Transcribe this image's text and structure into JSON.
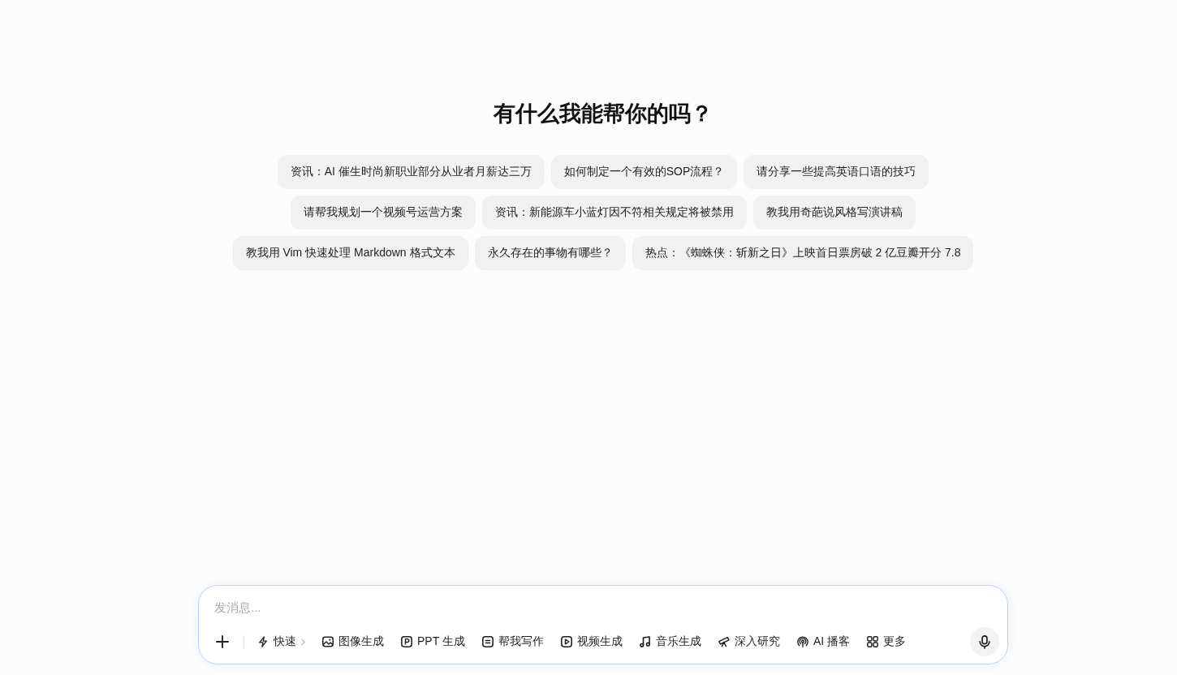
{
  "heading": "有什么我能帮你的吗？",
  "suggestion_rows": [
    [
      "资讯：AI 催生时尚新职业部分从业者月薪达三万",
      "如何制定一个有效的SOP流程？",
      "请分享一些提高英语口语的技巧"
    ],
    [
      "请帮我规划一个视频号运营方案",
      "资讯：新能源车小蓝灯因不符相关规定将被禁用",
      "教我用奇葩说风格写演讲稿"
    ],
    [
      "教我用 Vim 快速处理 Markdown 格式文本",
      "永久存在的事物有哪些？",
      "热点：《蜘蛛侠：斩新之日》上映首日票房破 2 亿豆瓣开分 7.8"
    ]
  ],
  "composer": {
    "placeholder": "发消息...",
    "tools": [
      {
        "label": "快速",
        "kind": "dropdown"
      },
      {
        "label": "图像生成",
        "kind": "tool"
      },
      {
        "label": "PPT 生成",
        "kind": "tool"
      },
      {
        "label": "帮我写作",
        "kind": "tool"
      },
      {
        "label": "视频生成",
        "kind": "tool"
      },
      {
        "label": "音乐生成",
        "kind": "tool"
      },
      {
        "label": "深入研究",
        "kind": "tool"
      },
      {
        "label": "AI 播客",
        "kind": "tool"
      },
      {
        "label": "更多",
        "kind": "tool"
      }
    ]
  }
}
